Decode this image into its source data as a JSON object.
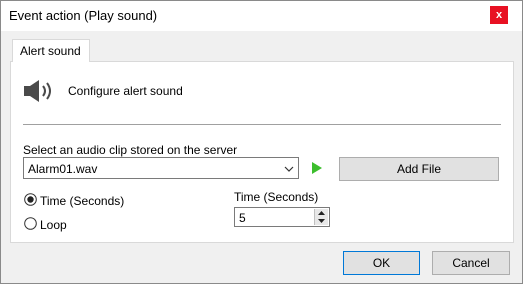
{
  "window": {
    "title": "Event action (Play sound)",
    "close_glyph": "x",
    "close_color": "#e81123"
  },
  "tabs": [
    {
      "label": "Alert sound",
      "active": true
    }
  ],
  "panel": {
    "header_icon": "speaker-icon",
    "header_text": "Configure alert sound",
    "select_label": "Select an audio clip stored on the server",
    "selected_clip": "Alarm01.wav",
    "play_icon": "play-icon",
    "play_color": "#3cbe2d",
    "add_file_label": "Add File",
    "mode_options": [
      {
        "label": "Time (Seconds)",
        "selected": true
      },
      {
        "label": "Loop",
        "selected": false
      }
    ],
    "duration_label": "Time (Seconds)",
    "duration_value": "5"
  },
  "buttons": {
    "ok_label": "OK",
    "cancel_label": "Cancel"
  }
}
